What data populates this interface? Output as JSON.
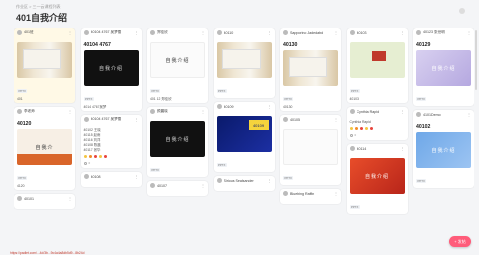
{
  "breadcrumb": "作业区 > 三一云课程列表",
  "page_title": "401自我介绍",
  "url_bar": "https://padlet.com/...4d/3b...9c4a4a8db5d9...8b24d",
  "fab_label": "+ 发帖",
  "reaction_colors": [
    "#f4c542",
    "#f28c28",
    "#e8453c",
    "#f4c542",
    "#e8453c"
  ],
  "columns": [
    {
      "cards": [
        {
          "user": "401班",
          "sub": "",
          "title": "",
          "lines": [],
          "thumb": "paper",
          "thumb_text": "",
          "tag": "PPTX",
          "count": "401",
          "foot": "0",
          "hl": true
        },
        {
          "user": "李老师",
          "sub": "",
          "title": "40120",
          "lines": [],
          "thumb": "orange",
          "thumb_text": "自我介",
          "tag": "PPTX",
          "count": "4120",
          "foot": "0"
        },
        {
          "user": "40101",
          "sub": "",
          "title": "",
          "lines": [],
          "thumb": "",
          "thumb_text": "",
          "tag": "",
          "count": "",
          "foot": ""
        }
      ]
    },
    {
      "cards": [
        {
          "user": "40104 4767 吴梦雪",
          "sub": "",
          "title": "40104 4767",
          "lines": [],
          "thumb": "dark",
          "thumb_text": "自我介绍",
          "tag": "PPTX",
          "count": "4014 4767吴梦",
          "foot": "0"
        },
        {
          "user": "40104 4767 吴梦雪",
          "sub": "",
          "title": "",
          "lines": [
            "40102 王晓",
            "40115 赵雨",
            "40116 刘洋",
            "40108 陈晨",
            "40117 张华"
          ],
          "thumb": "",
          "thumb_text": "",
          "tag": "",
          "count": "",
          "foot": "0"
        },
        {
          "user": "40108",
          "sub": "",
          "title": "",
          "lines": [],
          "thumb": "",
          "thumb_text": "",
          "tag": "",
          "count": "",
          "foot": ""
        }
      ]
    },
    {
      "cards": [
        {
          "user": "郑佳欣",
          "sub": "",
          "title": "",
          "lines": [],
          "thumb": "white",
          "thumb_text": "自我介绍",
          "tag": "PPTX",
          "count": "401 12 郑佳欣",
          "foot": "0"
        },
        {
          "user": "颜晨晓",
          "sub": "",
          "title": "",
          "lines": [],
          "thumb": "dark",
          "thumb_text": "自我介绍",
          "tag": "PPTX",
          "count": "",
          "foot": "0"
        },
        {
          "user": "40107",
          "sub": "",
          "title": "",
          "lines": [],
          "thumb": "",
          "thumb_text": "",
          "tag": "",
          "count": "",
          "foot": ""
        }
      ]
    },
    {
      "cards": [
        {
          "user": "40110",
          "sub": "",
          "title": "",
          "lines": [],
          "thumb": "paper",
          "thumb_text": "",
          "tag": "PPTX",
          "count": "",
          "foot": "0"
        },
        {
          "user": "40109",
          "sub": "",
          "title": "",
          "lines": [],
          "thumb": "blue",
          "thumb_text": "40109",
          "tag": "PPTX",
          "count": "",
          "foot": "0"
        },
        {
          "user": "Sirious Sealsander",
          "sub": "",
          "title": "",
          "lines": [],
          "thumb": "",
          "thumb_text": "",
          "tag": "",
          "count": "",
          "foot": ""
        }
      ]
    },
    {
      "cards": [
        {
          "user": "Sapporino Jadedabd",
          "sub": "",
          "title": "40130",
          "lines": [],
          "thumb": "paper",
          "thumb_text": "",
          "tag": "PPTX",
          "count": "40130",
          "foot": "0"
        },
        {
          "user": "40105",
          "sub": "",
          "title": "",
          "lines": [],
          "thumb": "white",
          "thumb_text": "",
          "tag": "PPTX",
          "count": "",
          "foot": "0"
        },
        {
          "user": "Bluebing Raffin",
          "sub": "",
          "title": "",
          "lines": [],
          "thumb": "",
          "thumb_text": "",
          "tag": "",
          "count": "",
          "foot": ""
        }
      ]
    },
    {
      "cards": [
        {
          "user": "40103",
          "sub": "",
          "title": "",
          "lines": [],
          "thumb": "green",
          "thumb_text": "",
          "tag": "PPTX",
          "count": "40103",
          "foot": "0"
        },
        {
          "user": "Cynthia Rapid",
          "sub": "",
          "title": "",
          "lines": [
            "Cynthia Rapid"
          ],
          "thumb": "",
          "thumb_text": "",
          "tag": "",
          "count": "",
          "foot": "0"
        },
        {
          "user": "40114",
          "sub": "",
          "title": "",
          "lines": [],
          "thumb": "red",
          "thumb_text": "自我介绍",
          "tag": "PPTX",
          "count": "",
          "foot": "0"
        }
      ]
    },
    {
      "cards": [
        {
          "user": "40123 张世明",
          "sub": "",
          "title": "40129",
          "lines": [],
          "thumb": "purple",
          "thumb_text": "自我介绍",
          "tag": "PPTX",
          "count": "",
          "foot": "0"
        },
        {
          "user": "4101Demo",
          "sub": "",
          "title": "40102",
          "lines": [],
          "thumb": "sky",
          "thumb_text": "自我介绍",
          "tag": "PPTX",
          "count": "",
          "foot": "0"
        }
      ]
    }
  ]
}
